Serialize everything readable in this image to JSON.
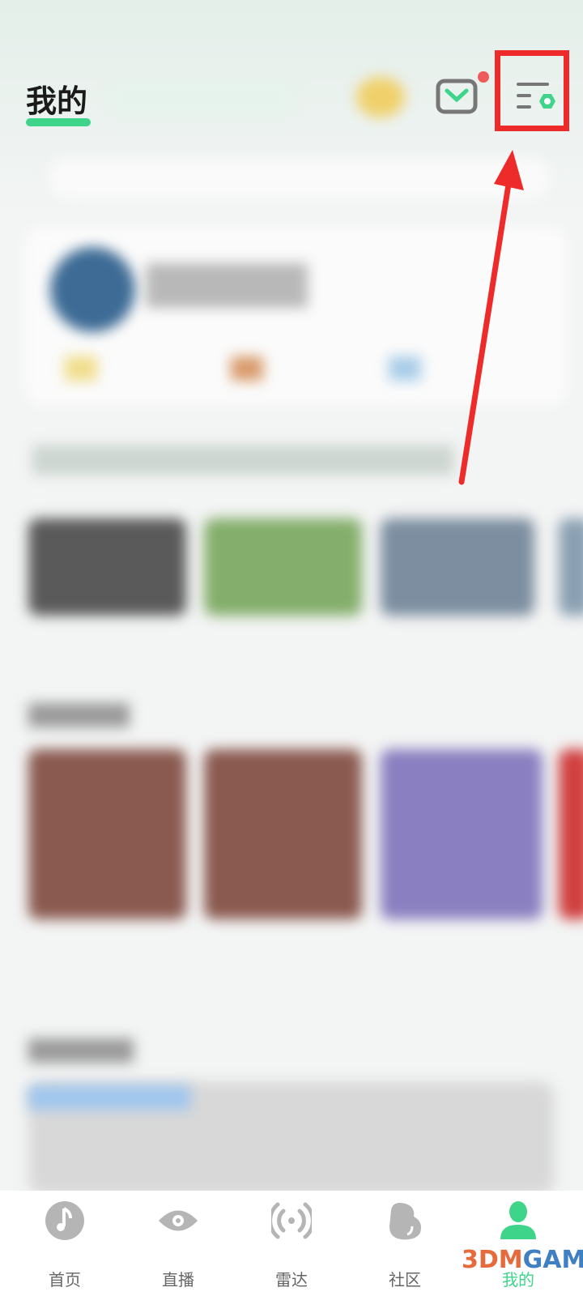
{
  "header": {
    "title": "我的",
    "icons": [
      "mail-icon",
      "settings-menu-icon"
    ],
    "accent": "#3ed58a",
    "notification_dot": true
  },
  "annotation": {
    "highlight_color": "#ee2b2b",
    "target": "settings-menu-icon"
  },
  "bottom_nav": {
    "items": [
      {
        "label": "首页",
        "icon": "music-note-icon",
        "active": false
      },
      {
        "label": "直播",
        "icon": "eye-icon",
        "active": false
      },
      {
        "label": "雷达",
        "icon": "radar-icon",
        "active": false
      },
      {
        "label": "社区",
        "icon": "bean-icon",
        "active": false
      },
      {
        "label": "我的",
        "icon": "user-icon",
        "active": true
      }
    ]
  },
  "watermark": {
    "text_a": "3DM",
    "text_b": "GAME"
  }
}
